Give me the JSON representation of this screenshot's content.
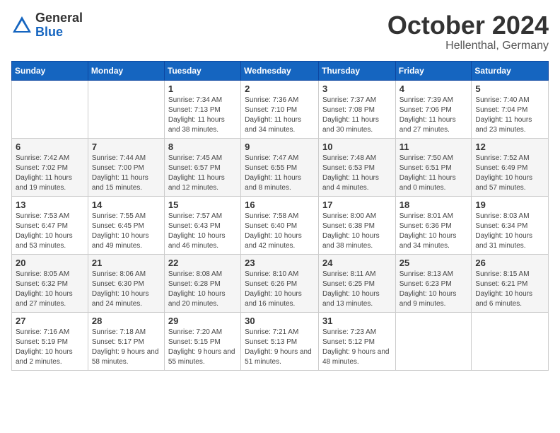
{
  "header": {
    "logo_general": "General",
    "logo_blue": "Blue",
    "month_title": "October 2024",
    "location": "Hellenthal, Germany"
  },
  "weekdays": [
    "Sunday",
    "Monday",
    "Tuesday",
    "Wednesday",
    "Thursday",
    "Friday",
    "Saturday"
  ],
  "weeks": [
    [
      {
        "day": "",
        "info": ""
      },
      {
        "day": "",
        "info": ""
      },
      {
        "day": "1",
        "info": "Sunrise: 7:34 AM\nSunset: 7:13 PM\nDaylight: 11 hours and 38 minutes."
      },
      {
        "day": "2",
        "info": "Sunrise: 7:36 AM\nSunset: 7:10 PM\nDaylight: 11 hours and 34 minutes."
      },
      {
        "day": "3",
        "info": "Sunrise: 7:37 AM\nSunset: 7:08 PM\nDaylight: 11 hours and 30 minutes."
      },
      {
        "day": "4",
        "info": "Sunrise: 7:39 AM\nSunset: 7:06 PM\nDaylight: 11 hours and 27 minutes."
      },
      {
        "day": "5",
        "info": "Sunrise: 7:40 AM\nSunset: 7:04 PM\nDaylight: 11 hours and 23 minutes."
      }
    ],
    [
      {
        "day": "6",
        "info": "Sunrise: 7:42 AM\nSunset: 7:02 PM\nDaylight: 11 hours and 19 minutes."
      },
      {
        "day": "7",
        "info": "Sunrise: 7:44 AM\nSunset: 7:00 PM\nDaylight: 11 hours and 15 minutes."
      },
      {
        "day": "8",
        "info": "Sunrise: 7:45 AM\nSunset: 6:57 PM\nDaylight: 11 hours and 12 minutes."
      },
      {
        "day": "9",
        "info": "Sunrise: 7:47 AM\nSunset: 6:55 PM\nDaylight: 11 hours and 8 minutes."
      },
      {
        "day": "10",
        "info": "Sunrise: 7:48 AM\nSunset: 6:53 PM\nDaylight: 11 hours and 4 minutes."
      },
      {
        "day": "11",
        "info": "Sunrise: 7:50 AM\nSunset: 6:51 PM\nDaylight: 11 hours and 0 minutes."
      },
      {
        "day": "12",
        "info": "Sunrise: 7:52 AM\nSunset: 6:49 PM\nDaylight: 10 hours and 57 minutes."
      }
    ],
    [
      {
        "day": "13",
        "info": "Sunrise: 7:53 AM\nSunset: 6:47 PM\nDaylight: 10 hours and 53 minutes."
      },
      {
        "day": "14",
        "info": "Sunrise: 7:55 AM\nSunset: 6:45 PM\nDaylight: 10 hours and 49 minutes."
      },
      {
        "day": "15",
        "info": "Sunrise: 7:57 AM\nSunset: 6:43 PM\nDaylight: 10 hours and 46 minutes."
      },
      {
        "day": "16",
        "info": "Sunrise: 7:58 AM\nSunset: 6:40 PM\nDaylight: 10 hours and 42 minutes."
      },
      {
        "day": "17",
        "info": "Sunrise: 8:00 AM\nSunset: 6:38 PM\nDaylight: 10 hours and 38 minutes."
      },
      {
        "day": "18",
        "info": "Sunrise: 8:01 AM\nSunset: 6:36 PM\nDaylight: 10 hours and 34 minutes."
      },
      {
        "day": "19",
        "info": "Sunrise: 8:03 AM\nSunset: 6:34 PM\nDaylight: 10 hours and 31 minutes."
      }
    ],
    [
      {
        "day": "20",
        "info": "Sunrise: 8:05 AM\nSunset: 6:32 PM\nDaylight: 10 hours and 27 minutes."
      },
      {
        "day": "21",
        "info": "Sunrise: 8:06 AM\nSunset: 6:30 PM\nDaylight: 10 hours and 24 minutes."
      },
      {
        "day": "22",
        "info": "Sunrise: 8:08 AM\nSunset: 6:28 PM\nDaylight: 10 hours and 20 minutes."
      },
      {
        "day": "23",
        "info": "Sunrise: 8:10 AM\nSunset: 6:26 PM\nDaylight: 10 hours and 16 minutes."
      },
      {
        "day": "24",
        "info": "Sunrise: 8:11 AM\nSunset: 6:25 PM\nDaylight: 10 hours and 13 minutes."
      },
      {
        "day": "25",
        "info": "Sunrise: 8:13 AM\nSunset: 6:23 PM\nDaylight: 10 hours and 9 minutes."
      },
      {
        "day": "26",
        "info": "Sunrise: 8:15 AM\nSunset: 6:21 PM\nDaylight: 10 hours and 6 minutes."
      }
    ],
    [
      {
        "day": "27",
        "info": "Sunrise: 7:16 AM\nSunset: 5:19 PM\nDaylight: 10 hours and 2 minutes."
      },
      {
        "day": "28",
        "info": "Sunrise: 7:18 AM\nSunset: 5:17 PM\nDaylight: 9 hours and 58 minutes."
      },
      {
        "day": "29",
        "info": "Sunrise: 7:20 AM\nSunset: 5:15 PM\nDaylight: 9 hours and 55 minutes."
      },
      {
        "day": "30",
        "info": "Sunrise: 7:21 AM\nSunset: 5:13 PM\nDaylight: 9 hours and 51 minutes."
      },
      {
        "day": "31",
        "info": "Sunrise: 7:23 AM\nSunset: 5:12 PM\nDaylight: 9 hours and 48 minutes."
      },
      {
        "day": "",
        "info": ""
      },
      {
        "day": "",
        "info": ""
      }
    ]
  ]
}
